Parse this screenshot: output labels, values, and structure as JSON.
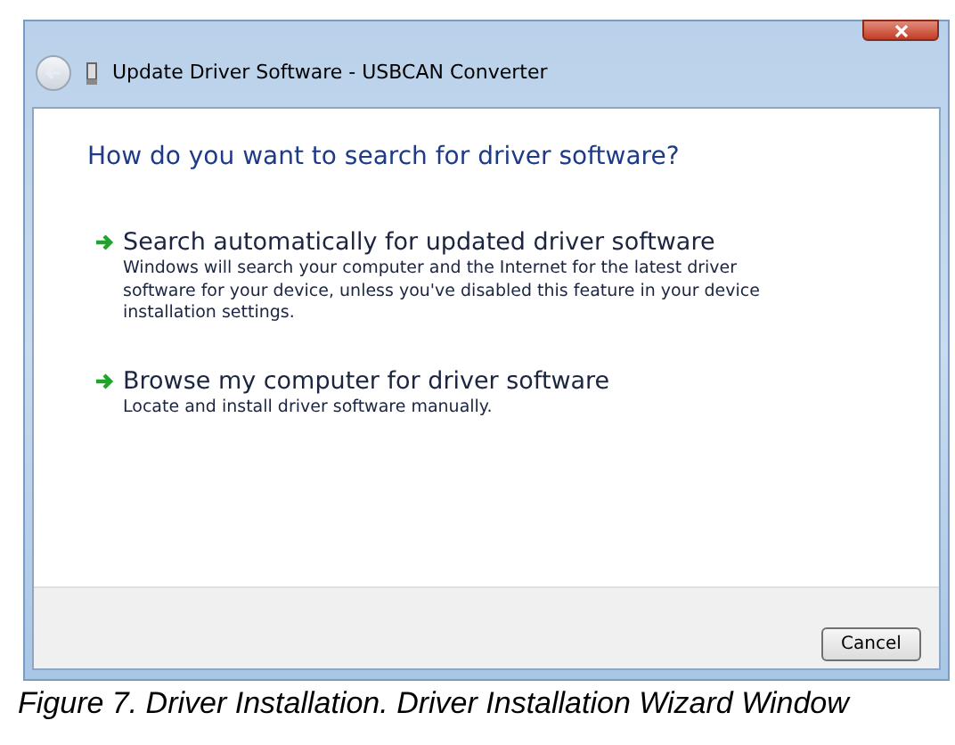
{
  "window": {
    "title": "Update Driver Software - USBCAN Converter"
  },
  "heading": "How do you want to search for driver software?",
  "options": [
    {
      "title": "Search automatically for updated driver software",
      "description": "Windows will search your computer and the Internet for the latest driver software for your device, unless you've disabled this feature in your device installation settings."
    },
    {
      "title": "Browse my computer for driver software",
      "description": "Locate and install driver software manually."
    }
  ],
  "buttons": [
    "Cancel"
  ],
  "caption": "Figure 7. Driver Installation. Driver Installation Wizard Window"
}
